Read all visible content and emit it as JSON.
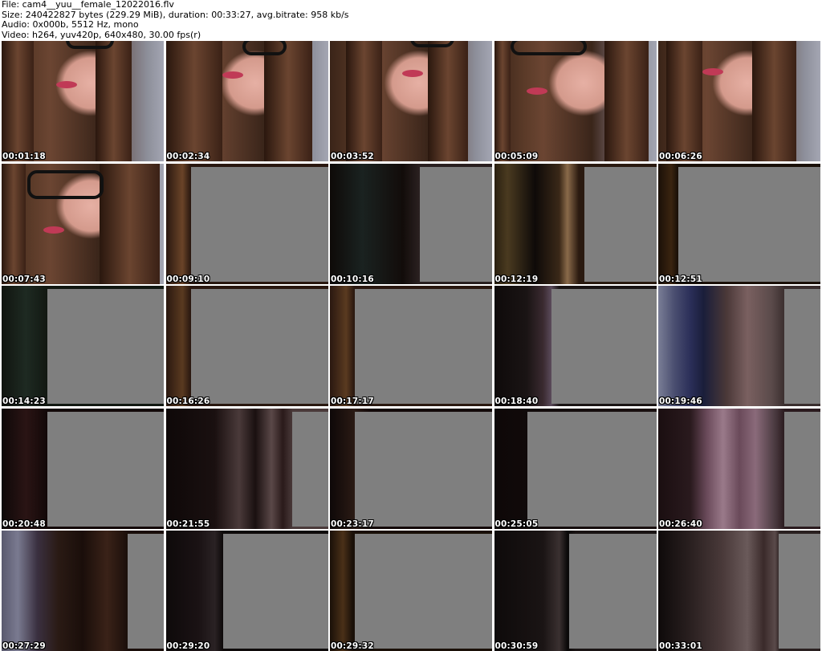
{
  "header": {
    "file": "File: cam4__yuu__female_12022016.flv",
    "size": "Size: 240422827 bytes (229.29 MiB), duration: 00:33:27, avg.bitrate: 958 kb/s",
    "audio": "Audio: 0x000b, 5512 Hz, mono",
    "video": "Video: h264, yuv420p, 640x480, 30.00 fps(r)"
  },
  "thumbnails": [
    {
      "time": "00:01:18"
    },
    {
      "time": "00:02:34"
    },
    {
      "time": "00:03:52"
    },
    {
      "time": "00:05:09"
    },
    {
      "time": "00:06:26"
    },
    {
      "time": "00:07:43"
    },
    {
      "time": "00:09:10"
    },
    {
      "time": "00:10:16"
    },
    {
      "time": "00:12:19"
    },
    {
      "time": "00:12:51"
    },
    {
      "time": "00:14:23"
    },
    {
      "time": "00:16:26"
    },
    {
      "time": "00:17:17"
    },
    {
      "time": "00:18:40"
    },
    {
      "time": "00:19:46"
    },
    {
      "time": "00:20:48"
    },
    {
      "time": "00:21:55"
    },
    {
      "time": "00:23:17"
    },
    {
      "time": "00:25:05"
    },
    {
      "time": "00:26:40"
    },
    {
      "time": "00:27:29"
    },
    {
      "time": "00:29:20"
    },
    {
      "time": "00:29:32"
    },
    {
      "time": "00:30:59"
    },
    {
      "time": "00:33:01"
    }
  ]
}
